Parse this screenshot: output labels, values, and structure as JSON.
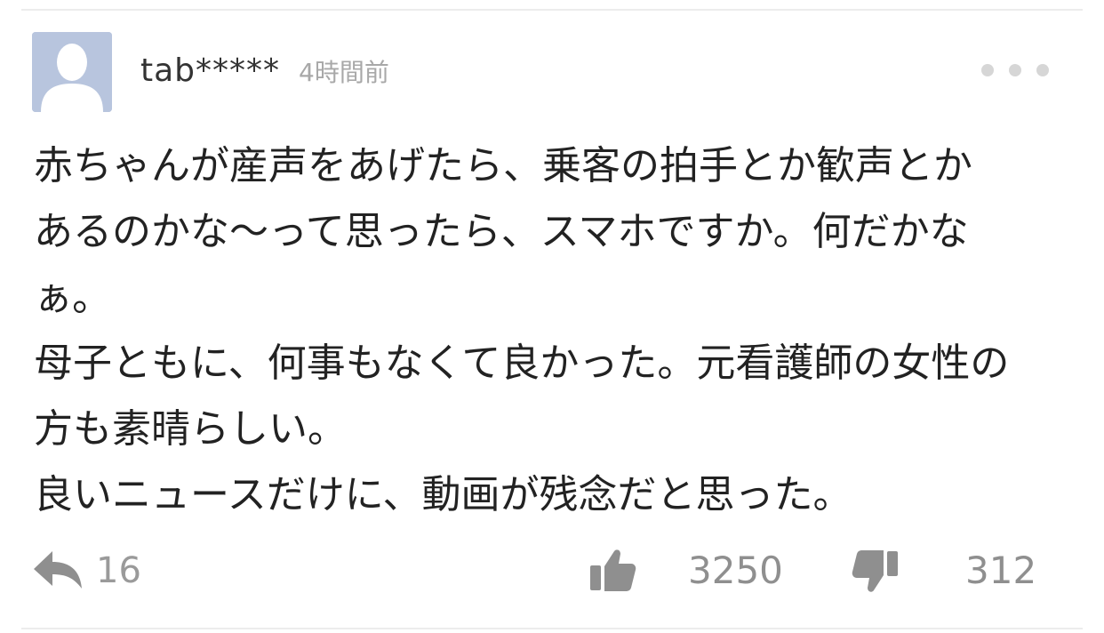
{
  "comment": {
    "username": "tab*****",
    "timestamp": "4時間前",
    "body_lines": [
      "赤ちゃんが産声をあげたら、乗客の拍手とか歓声とか",
      "あるのかな〜って思ったら、スマホですか。何だかな",
      "ぁ。",
      "母子ともに、何事もなくて良かった。元看護師の女性の",
      "方も素晴らしい。",
      "良いニュースだけに、動画が残念だと思った。"
    ]
  },
  "actions": {
    "reply_count": "16",
    "like_count": "3250",
    "dislike_count": "312"
  },
  "icons": {
    "avatar": "default-user-silhouette",
    "more": "more-horizontal-icon",
    "reply": "reply-arrow-icon",
    "like": "thumbs-up-icon",
    "dislike": "thumbs-down-icon"
  },
  "colors": {
    "avatar_bg": "#b8c5de",
    "username": "#333333",
    "muted": "#a8a8a8",
    "icon": "#8f8f8f"
  }
}
